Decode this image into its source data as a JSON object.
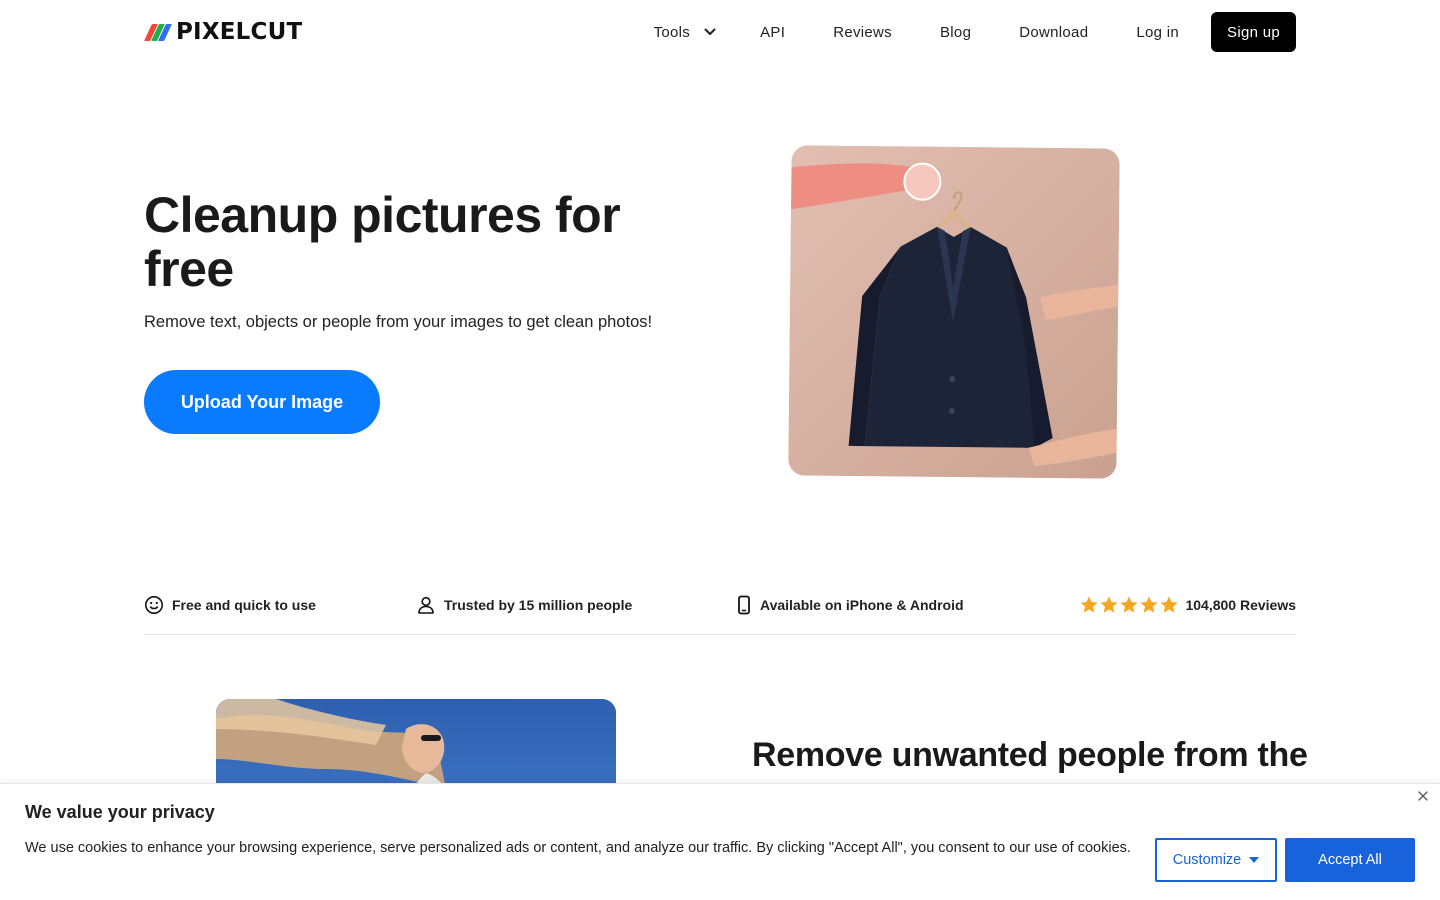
{
  "header": {
    "logo_text": "PIXELCUT",
    "logo_colors": [
      "#f2463a",
      "#22b04b",
      "#2f6ff2"
    ],
    "nav": {
      "tools": "Tools",
      "api": "API",
      "reviews": "Reviews",
      "blog": "Blog",
      "download": "Download",
      "login": "Log in",
      "signup": "Sign up"
    }
  },
  "hero": {
    "title": "Cleanup pictures for free",
    "subtitle": "Remove text, objects or people from your images to get clean photos!",
    "upload_button": "Upload Your Image",
    "accent_color": "#0a7aff"
  },
  "features": [
    {
      "icon": "smiley-icon",
      "label": "Free and quick to use"
    },
    {
      "icon": "person-icon",
      "label": "Trusted by 15 million people"
    },
    {
      "icon": "phone-icon",
      "label": "Available on iPhone & Android"
    },
    {
      "icon": "star-icon",
      "label": "104,800 Reviews",
      "stars": 5
    }
  ],
  "section2": {
    "title": "Remove unwanted people from the"
  },
  "cookie_banner": {
    "title": "We value your privacy",
    "text": "We use cookies to enhance your browsing experience, serve personalized ads or content, and analyze our traffic. By clicking \"Accept All\", you consent to our use of cookies.",
    "customize": "Customize",
    "accept_all": "Accept All",
    "accent_color": "#1863dc"
  }
}
